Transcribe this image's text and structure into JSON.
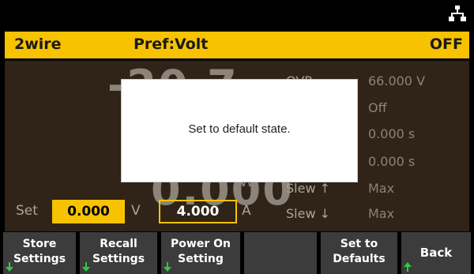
{
  "status": {
    "wire": "2wire",
    "priority": "Pref:Volt",
    "output": "OFF"
  },
  "readings": {
    "voltage_partial": "-20.7",
    "power_partial": "0.000",
    "power_unit": "W"
  },
  "protection": {
    "ovp_label": "OVP",
    "ovp_value": "66.000 V",
    "r2_value": "Off",
    "r3_value": "0.000 s",
    "r4_value": "0.000 s",
    "slew_up_label": "Slew ↑",
    "slew_up_value": "Max",
    "slew_down_label": "Slew ↓",
    "slew_down_value": "Max"
  },
  "settings": {
    "set_label": "Set",
    "voltage": "0.000",
    "voltage_unit": "V",
    "current": "4.000",
    "current_unit": "A"
  },
  "dialog": {
    "message": "Set to default state."
  },
  "softkeys": [
    {
      "line1": "Store",
      "line2": "Settings"
    },
    {
      "line1": "Recall",
      "line2": "Settings"
    },
    {
      "line1": "Power On",
      "line2": "Setting"
    },
    {
      "line1": "",
      "line2": ""
    },
    {
      "line1": "Set to",
      "line2": "Defaults"
    },
    {
      "line1": "Back",
      "line2": ""
    }
  ],
  "icons": {
    "lan": "lan-network-icon",
    "softkey_arrow": "arrow-down-icon",
    "defaults_arrow": "arrow-up-icon"
  },
  "colors": {
    "accent": "#f7c300",
    "panel": "#2f2417",
    "softkey": "#3c3c3c",
    "arrow": "#2ecc40"
  }
}
